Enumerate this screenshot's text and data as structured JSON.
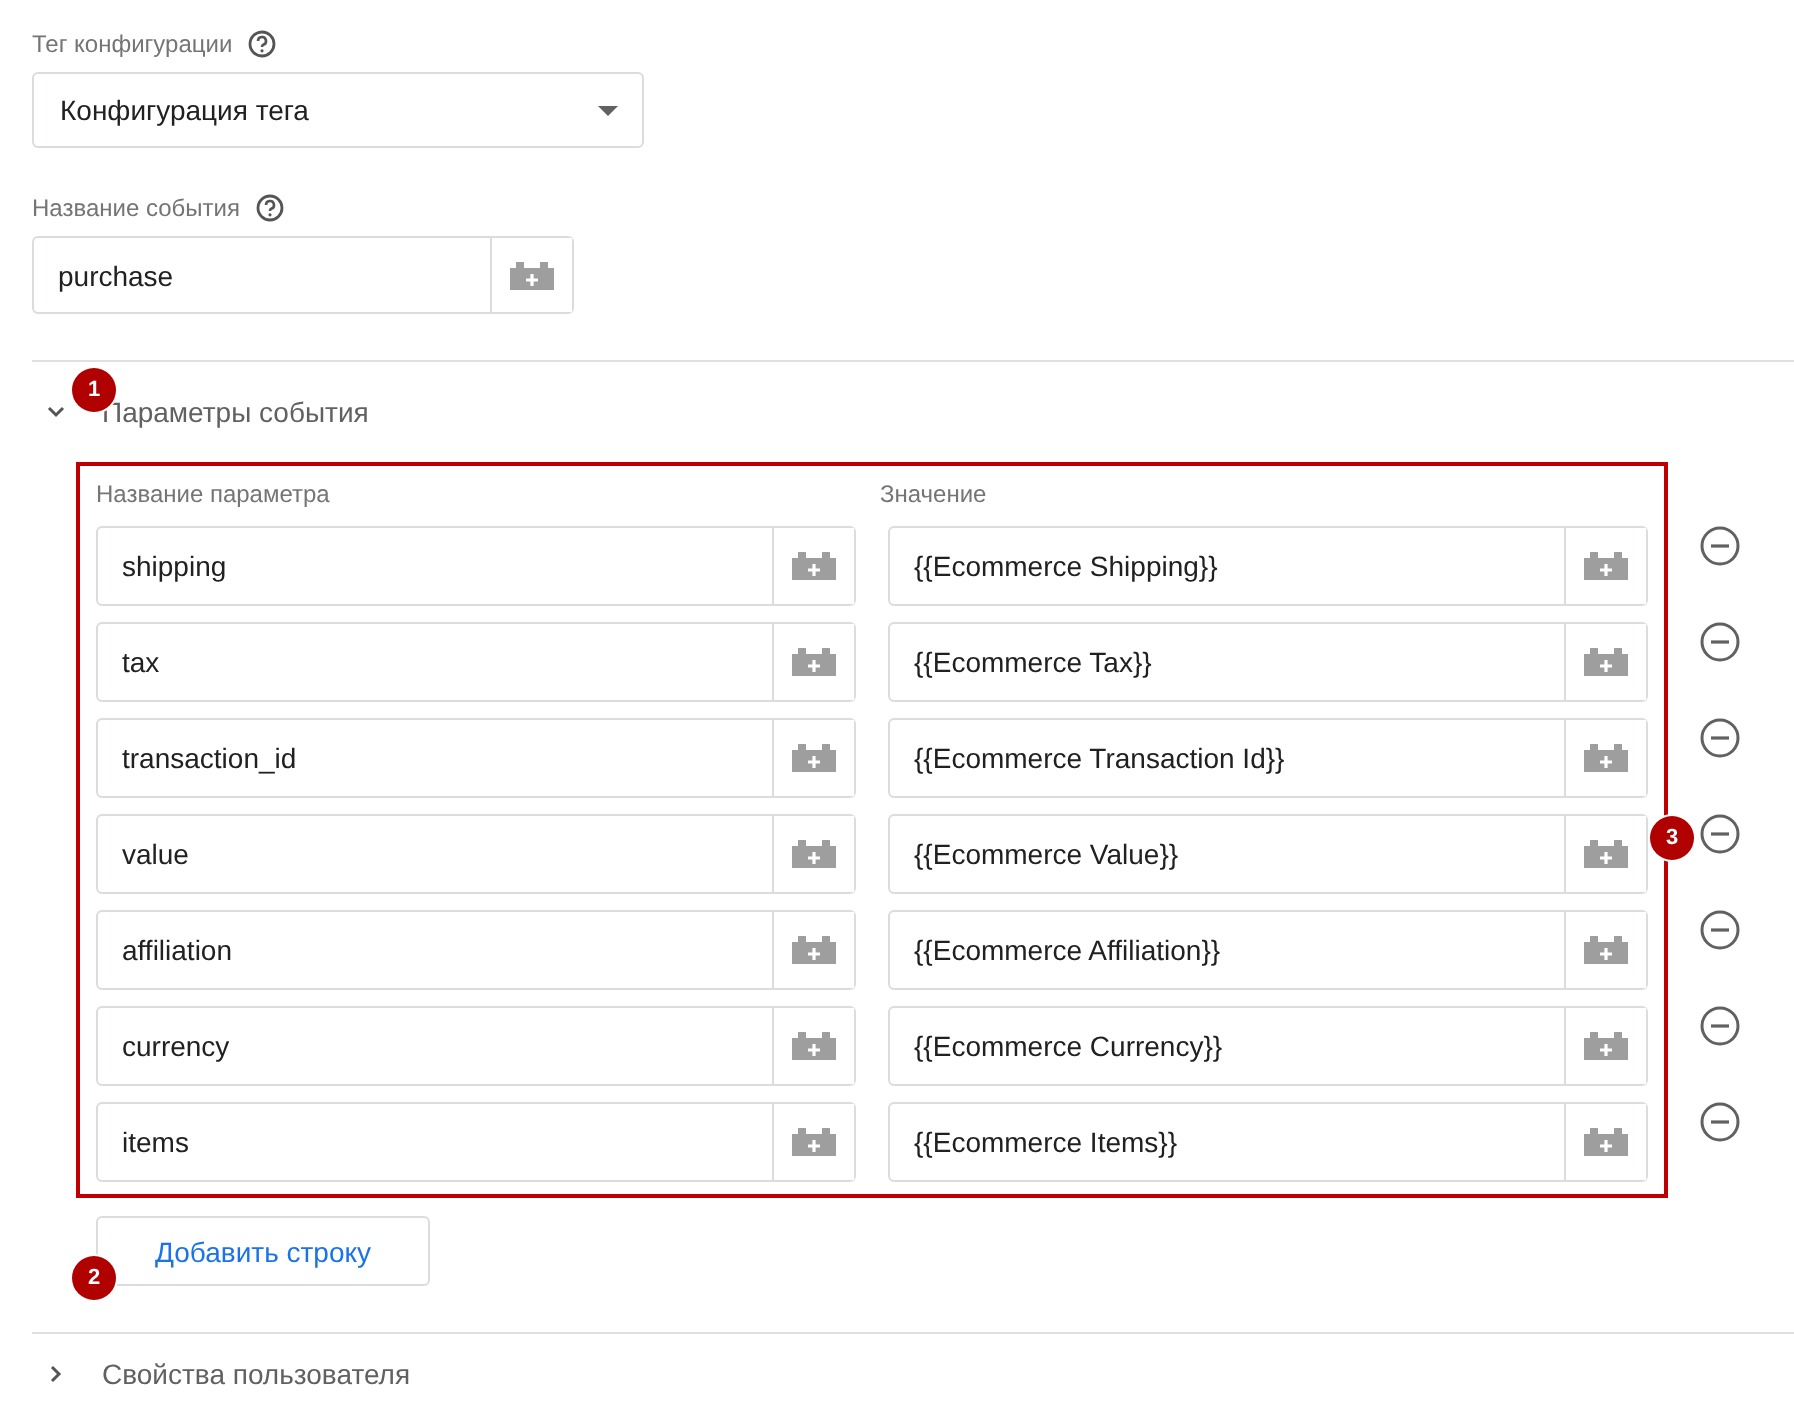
{
  "tag_config": {
    "label": "Тег конфигурации",
    "value": "Конфигурация тега"
  },
  "event_name": {
    "label": "Название события",
    "value": "purchase"
  },
  "event_params": {
    "title": "Параметры события",
    "expanded": true,
    "badge": "1",
    "columns": [
      "Название параметра",
      "Значение"
    ],
    "highlight_badge": "3",
    "rows": [
      {
        "name": "shipping",
        "value": "{{Ecommerce Shipping}}"
      },
      {
        "name": "tax",
        "value": "{{Ecommerce Tax}}"
      },
      {
        "name": "transaction_id",
        "value": "{{Ecommerce Transaction Id}}"
      },
      {
        "name": "value",
        "value": "{{Ecommerce Value}}"
      },
      {
        "name": "affiliation",
        "value": "{{Ecommerce Affiliation}}"
      },
      {
        "name": "currency",
        "value": "{{Ecommerce Currency}}"
      },
      {
        "name": "items",
        "value": "{{Ecommerce Items}}"
      }
    ],
    "add_button": "Добавить строку",
    "add_badge": "2"
  },
  "user_props": {
    "title": "Свойства пользователя",
    "expanded": false
  }
}
